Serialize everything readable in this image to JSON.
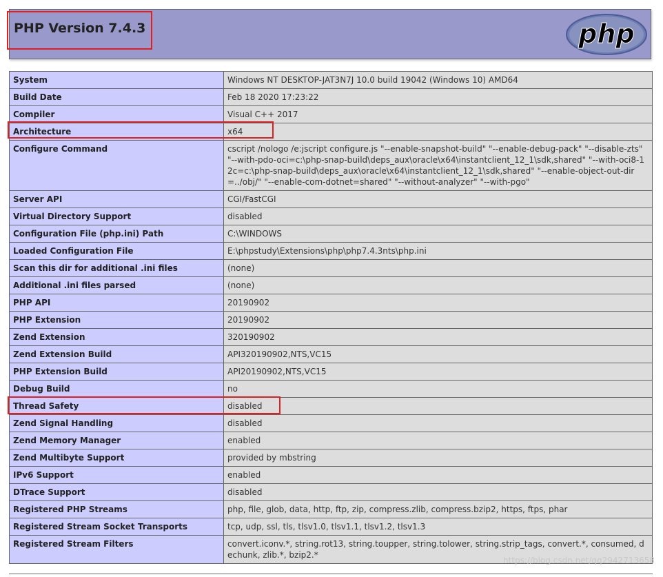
{
  "header": {
    "title": "PHP Version 7.4.3",
    "logo_text": "php"
  },
  "rows": [
    {
      "key": "System",
      "value": "Windows NT DESKTOP-JAT3N7J 10.0 build 19042 (Windows 10) AMD64"
    },
    {
      "key": "Build Date",
      "value": "Feb 18 2020 17:23:22"
    },
    {
      "key": "Compiler",
      "value": "Visual C++ 2017"
    },
    {
      "key": "Architecture",
      "value": "x64"
    },
    {
      "key": "Configure Command",
      "value": "cscript /nologo /e:jscript configure.js \"--enable-snapshot-build\" \"--enable-debug-pack\" \"--disable-zts\" \"--with-pdo-oci=c:\\php-snap-build\\deps_aux\\oracle\\x64\\instantclient_12_1\\sdk,shared\" \"--with-oci8-12c=c:\\php-snap-build\\deps_aux\\oracle\\x64\\instantclient_12_1\\sdk,shared\" \"--enable-object-out-dir=../obj/\" \"--enable-com-dotnet=shared\" \"--without-analyzer\" \"--with-pgo\""
    },
    {
      "key": "Server API",
      "value": "CGI/FastCGI"
    },
    {
      "key": "Virtual Directory Support",
      "value": "disabled"
    },
    {
      "key": "Configuration File (php.ini) Path",
      "value": "C:\\WINDOWS"
    },
    {
      "key": "Loaded Configuration File",
      "value": "E:\\phpstudy\\Extensions\\php\\php7.4.3nts\\php.ini"
    },
    {
      "key": "Scan this dir for additional .ini files",
      "value": "(none)"
    },
    {
      "key": "Additional .ini files parsed",
      "value": "(none)"
    },
    {
      "key": "PHP API",
      "value": "20190902"
    },
    {
      "key": "PHP Extension",
      "value": "20190902"
    },
    {
      "key": "Zend Extension",
      "value": "320190902"
    },
    {
      "key": "Zend Extension Build",
      "value": "API320190902,NTS,VC15"
    },
    {
      "key": "PHP Extension Build",
      "value": "API20190902,NTS,VC15"
    },
    {
      "key": "Debug Build",
      "value": "no"
    },
    {
      "key": "Thread Safety",
      "value": "disabled"
    },
    {
      "key": "Zend Signal Handling",
      "value": "disabled"
    },
    {
      "key": "Zend Memory Manager",
      "value": "enabled"
    },
    {
      "key": "Zend Multibyte Support",
      "value": "provided by mbstring"
    },
    {
      "key": "IPv6 Support",
      "value": "enabled"
    },
    {
      "key": "DTrace Support",
      "value": "disabled"
    },
    {
      "key": "Registered PHP Streams",
      "value": "php, file, glob, data, http, ftp, zip, compress.zlib, compress.bzip2, https, ftps, phar"
    },
    {
      "key": "Registered Stream Socket Transports",
      "value": "tcp, udp, ssl, tls, tlsv1.0, tlsv1.1, tlsv1.2, tlsv1.3"
    },
    {
      "key": "Registered Stream Filters",
      "value": "convert.iconv.*, string.rot13, string.toupper, string.tolower, string.strip_tags, convert.*, consumed, dechunk, zlib.*, bzip2.*"
    }
  ],
  "watermark": "https://blog.csdn.net/qq2942713658",
  "colors": {
    "header_bg": "#9999cc",
    "key_bg": "#ccccff",
    "value_bg": "#dddddd",
    "highlight": "#e02020"
  }
}
